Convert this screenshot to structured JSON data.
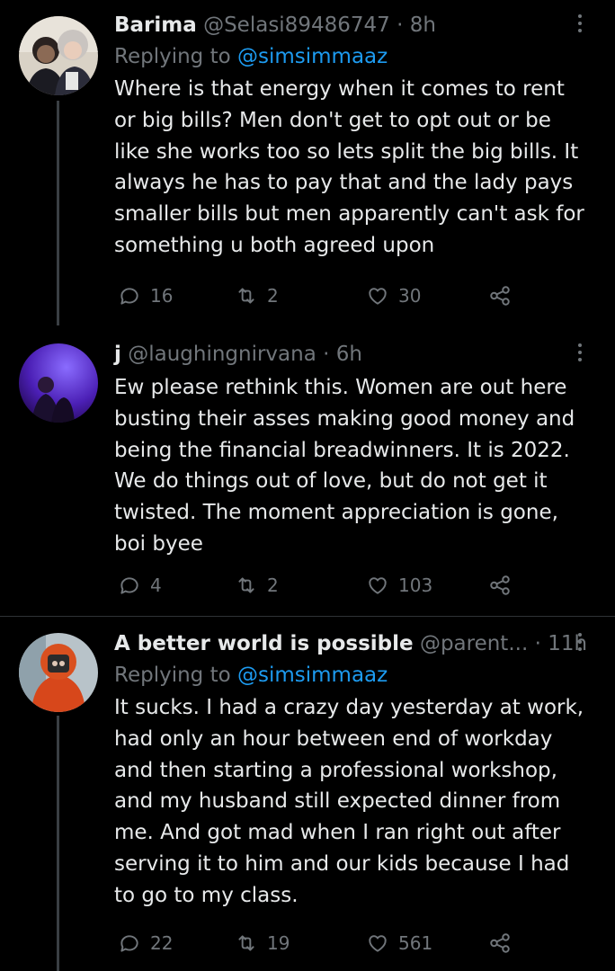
{
  "tweets": [
    {
      "name": "Barima",
      "handle": "@Selasi89486747",
      "dot": "·",
      "time": "8h",
      "replying_prefix": "Replying to ",
      "replying_to": "@simsimmaaz",
      "text": "Where is that energy when it comes to rent\nor big bills? Men don't get to opt out or be\nlike she works too so lets split the big bills. It\nalways he has to pay that and the lady pays\nsmaller bills but men apparently can't ask for\nsomething u both agreed upon",
      "replies": "16",
      "retweets": "2",
      "likes": "30"
    },
    {
      "name": "ϳ",
      "handle": "@laughingnirvana",
      "dot": "·",
      "time": "6h",
      "text": "Ew please rethink this. Women are out here\nbusting their asses making good money and\nbeing the financial breadwinners. It is 2022.\nWe do things out of love, but do not get it\ntwisted. The moment appreciation is gone,\nboi byee",
      "replies": "4",
      "retweets": "2",
      "likes": "103"
    },
    {
      "name": "A better world is possible",
      "handle": "@parent...",
      "dot": "·",
      "time": "11h",
      "replying_prefix": "Replying to ",
      "replying_to": "@simsimmaaz",
      "text": "It sucks. I had a crazy day yesterday at work,\nhad only an hour between end of workday\nand then starting a professional workshop,\nand my husband still expected dinner from\nme. And got mad when I ran right out after\nserving it to him and our kids because I had\nto go to my class.",
      "replies": "22",
      "retweets": "19",
      "likes": "561"
    }
  ],
  "icons": {
    "reply": "reply-icon",
    "retweet": "retweet-icon",
    "like": "heart-icon",
    "share": "share-icon",
    "more": "more-options-icon"
  },
  "colors": {
    "background": "#000000",
    "text": "#e7e9ea",
    "muted": "#71767b",
    "link": "#1d9bf0",
    "divider": "#2f3336"
  }
}
